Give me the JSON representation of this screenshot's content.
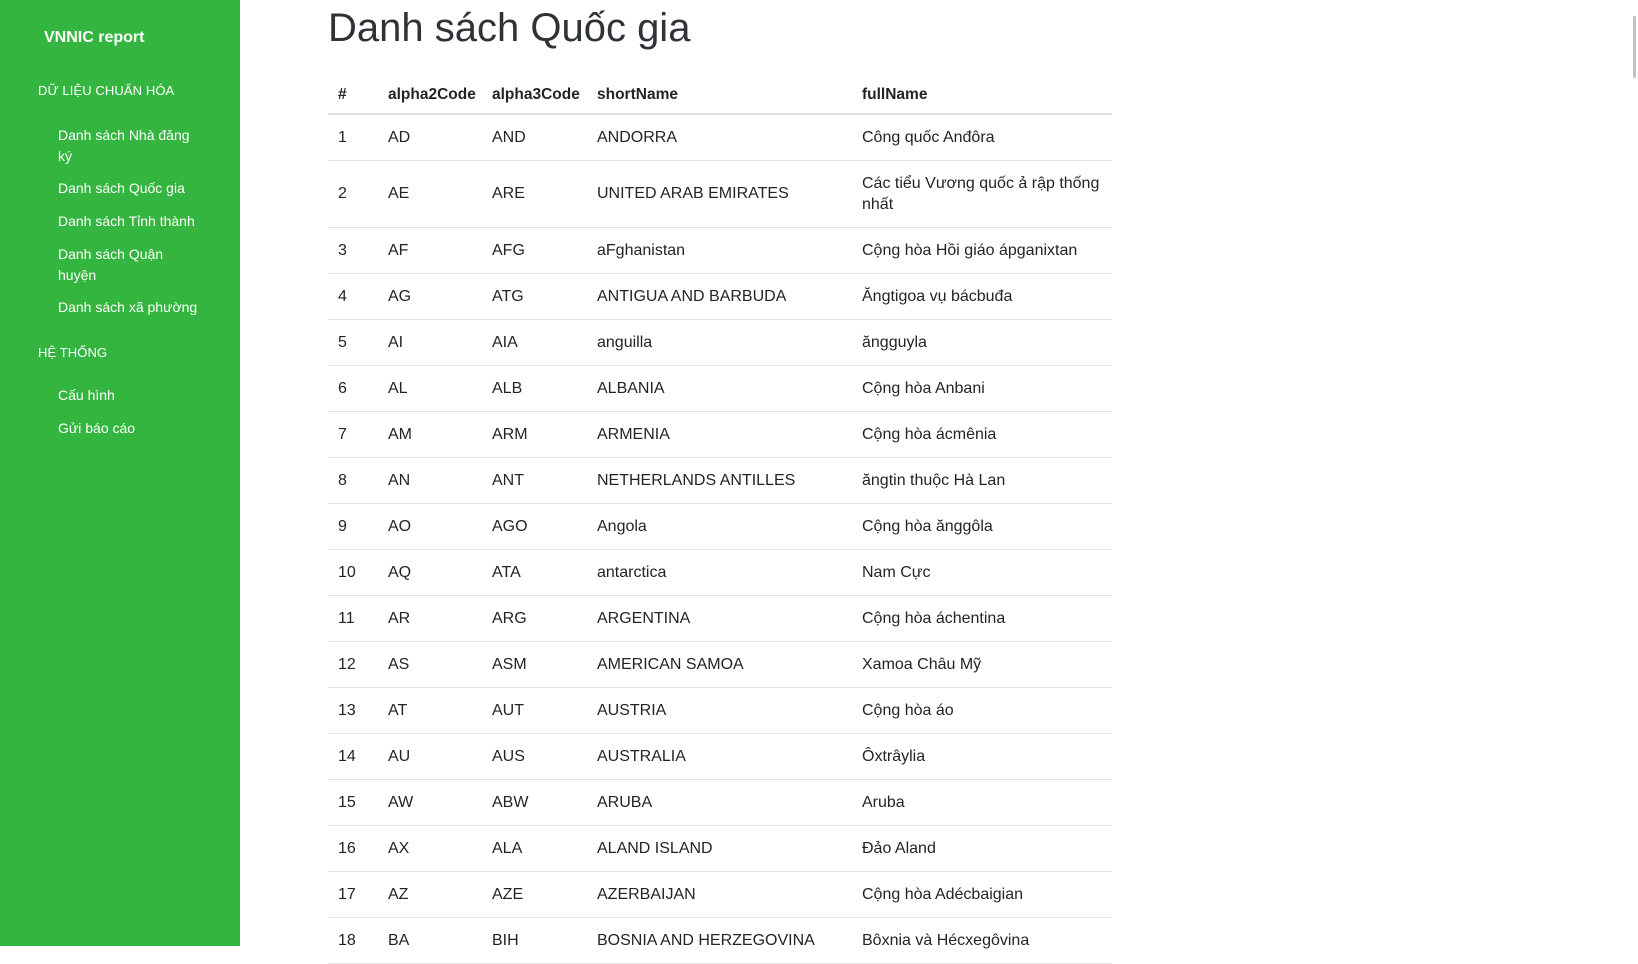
{
  "sidebar": {
    "brand": "VNNIC report",
    "sections": [
      {
        "title": "DỮ LIỆU CHUẨN HÓA",
        "items": [
          "Danh sách Nhà đăng ký",
          "Danh sách Quốc gia",
          "Danh sách Tỉnh thành",
          "Danh sách Quận huyện",
          "Danh sách xã phường"
        ]
      },
      {
        "title": "HỆ THỐNG",
        "items": [
          "Cấu hình",
          "Gửi báo cáo"
        ]
      }
    ]
  },
  "main": {
    "title": "Danh sách Quốc gia",
    "table": {
      "headers": [
        "#",
        "alpha2Code",
        "alpha3Code",
        "shortName",
        "fullName"
      ],
      "rows": [
        [
          "1",
          "AD",
          "AND",
          "ANDORRA",
          "Công quốc Anđôra"
        ],
        [
          "2",
          "AE",
          "ARE",
          "UNITED ARAB EMIRATES",
          "Các tiểu Vương quốc ả rập thống nhất"
        ],
        [
          "3",
          "AF",
          "AFG",
          "aFghanistan",
          "Cộng hòa Hồi giáo ápganixtan"
        ],
        [
          "4",
          "AG",
          "ATG",
          "ANTIGUA AND BARBUDA",
          "Ăngtigoa vụ bácbuđa"
        ],
        [
          "5",
          "AI",
          "AIA",
          "anguilla",
          "ăngguyla"
        ],
        [
          "6",
          "AL",
          "ALB",
          "ALBANIA",
          "Cộng hòa Anbani"
        ],
        [
          "7",
          "AM",
          "ARM",
          "ARMENIA",
          "Cộng hòa ácmênia"
        ],
        [
          "8",
          "AN",
          "ANT",
          "NETHERLANDS ANTILLES",
          "ăngtin thuộc Hà Lan"
        ],
        [
          "9",
          "AO",
          "AGO",
          "Angola",
          "Cộng hòa ănggôla"
        ],
        [
          "10",
          "AQ",
          "ATA",
          "antarctica",
          "Nam Cực"
        ],
        [
          "11",
          "AR",
          "ARG",
          "ARGENTINA",
          "Cộng hòa áchentina"
        ],
        [
          "12",
          "AS",
          "ASM",
          "AMERICAN SAMOA",
          "Xamoa Châu Mỹ"
        ],
        [
          "13",
          "AT",
          "AUT",
          "AUSTRIA",
          "Cộng hòa áo"
        ],
        [
          "14",
          "AU",
          "AUS",
          "AUSTRALIA",
          "Ôxtrâylia"
        ],
        [
          "15",
          "AW",
          "ABW",
          "ARUBA",
          "Aruba"
        ],
        [
          "16",
          "AX",
          "ALA",
          "ALAND ISLAND",
          "Đảo Aland"
        ],
        [
          "17",
          "AZ",
          "AZE",
          "AZERBAIJAN",
          "Cộng hòa Adécbaigian"
        ],
        [
          "18",
          "BA",
          "BIH",
          "BOSNIA AND HERZEGOVINA",
          "Bôxnia và Hécxegôvina"
        ]
      ]
    }
  },
  "colors": {
    "sidebar_bg": "#34b53f",
    "sidebar_text": "#ffffff",
    "table_border": "#dee2e6"
  }
}
